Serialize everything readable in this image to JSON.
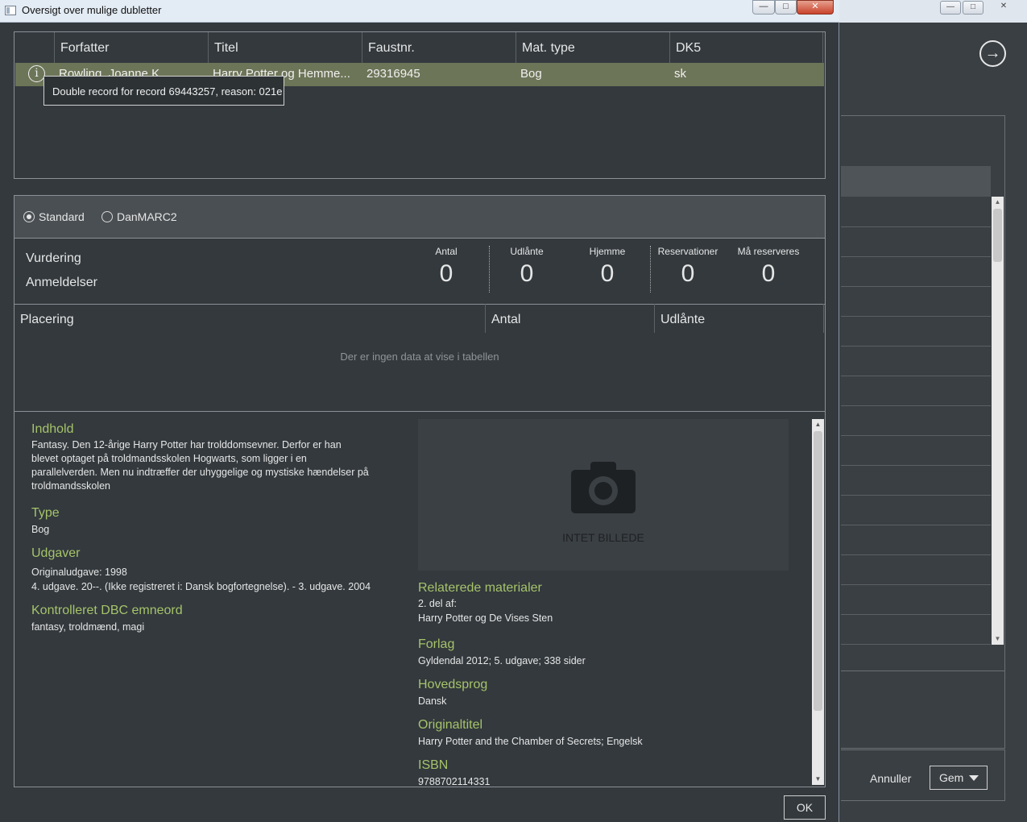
{
  "background_window": {
    "cancel_label": "Annuller",
    "save_label": "Gem"
  },
  "dialog": {
    "title": "Oversigt over mulige dubletter",
    "controls": {
      "minimize": "—",
      "maximize": "□",
      "close": "✕"
    }
  },
  "grid": {
    "columns": [
      "Forfatter",
      "Titel",
      "Faustnr.",
      "Mat. type",
      "DK5"
    ],
    "row": {
      "author": "Rowling, Joanne K.",
      "title": "Harry Potter og Hemme...",
      "faust": "29316945",
      "mat_type": "Bog",
      "dk5": "sk"
    },
    "tooltip": "Double record for record 69443257, reason: 021e"
  },
  "view_mode": {
    "options": [
      "Standard",
      "DanMARC2"
    ],
    "selected": "Standard"
  },
  "stats": {
    "left_labels": [
      "Vurdering",
      "Anmeldelser"
    ],
    "items": [
      {
        "label": "Antal",
        "value": "0"
      },
      {
        "label": "Udlånte",
        "value": "0"
      },
      {
        "label": "Hjemme",
        "value": "0"
      },
      {
        "label": "Reservationer",
        "value": "0"
      },
      {
        "label": "Må reserveres",
        "value": "0"
      }
    ]
  },
  "placement_table": {
    "columns": [
      "Placering",
      "Antal",
      "Udlånte"
    ],
    "empty_message": "Der er ingen data at vise i tabellen"
  },
  "details": {
    "indhold_heading": "Indhold",
    "indhold_text": "Fantasy. Den 12-årige Harry Potter har trolddomsevner. Derfor er han blevet optaget på troldmandsskolen Hogwarts, som ligger i en parallelverden. Men nu indtræffer der uhyggelige og mystiske hændelser på troldmandsskolen",
    "type_heading": "Type",
    "type_text": "Bog",
    "udgaver_heading": "Udgaver",
    "udgaver_line1": "Originaludgave: 1998",
    "udgaver_line2": "4. udgave. 20--. (Ikke registreret i: Dansk bogfortegnelse). - 3. udgave. 2004",
    "emneord_heading": "Kontrolleret DBC emneord",
    "emneord_text": "fantasy, troldmænd, magi",
    "no_image": "INTET BILLEDE",
    "relaterede_heading": "Relaterede materialer",
    "relaterede_line1": "2. del af:",
    "relaterede_line2": "Harry Potter og De Vises Sten",
    "forlag_heading": "Forlag",
    "forlag_text": "Gyldendal 2012; 5. udgave; 338 sider",
    "hovedsprog_heading": "Hovedsprog",
    "hovedsprog_text": "Dansk",
    "originaltitel_heading": "Originaltitel",
    "originaltitel_text": "Harry Potter and the Chamber of Secrets; Engelsk",
    "isbn_heading": "ISBN",
    "isbn_text": "9788702114331"
  },
  "ok_label": "OK"
}
